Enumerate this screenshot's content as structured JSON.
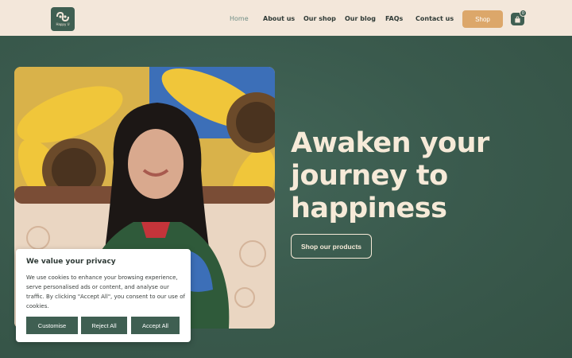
{
  "header": {
    "logo_text": "Happy U",
    "nav": [
      "Home",
      "About us",
      "Our shop",
      "Our blog",
      "FAQs",
      "Contact us"
    ],
    "shop_label": "Shop",
    "cart_count": "0"
  },
  "hero": {
    "title_lines": [
      "Awaken your",
      "journey to",
      "happiness"
    ],
    "cta_label": "Shop our products"
  },
  "cookie": {
    "title": "We value your privacy",
    "text": "We use cookies to enhance your browsing experience, serve personalised ads or content, and analyse our traffic. By clicking \"Accept All\", you consent to our use of cookies.",
    "customise_label": "Customise",
    "reject_label": "Reject All",
    "accept_label": "Accept All"
  },
  "colors": {
    "header_bg": "#f3e7da",
    "hero_bg": "#3a5a4d",
    "accent": "#dca76a",
    "dark_green": "#3f5f52"
  }
}
